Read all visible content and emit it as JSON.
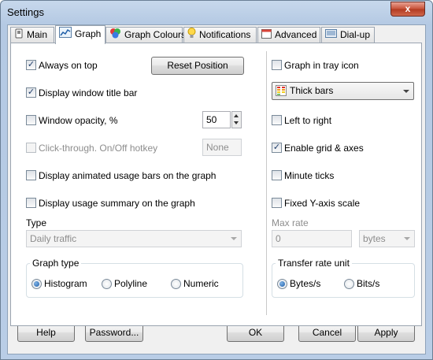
{
  "window": {
    "title": "Settings",
    "close_glyph": "x"
  },
  "tabs": [
    {
      "label": "Main",
      "icon": "phone-icon"
    },
    {
      "label": "Graph",
      "icon": "graph-icon",
      "active": true
    },
    {
      "label": "Graph Colours",
      "icon": "palette-icon"
    },
    {
      "label": "Notifications",
      "icon": "lightbulb-icon"
    },
    {
      "label": "Advanced",
      "icon": "calendar-icon"
    },
    {
      "label": "Dial-up",
      "icon": "modem-icon"
    }
  ],
  "left": {
    "always_on_top": {
      "label": "Always on top",
      "checked": true
    },
    "reset_position": "Reset Position",
    "display_title_bar": {
      "label": "Display window title bar",
      "checked": true
    },
    "window_opacity": {
      "label": "Window opacity, %",
      "checked": false,
      "value": "50"
    },
    "click_through": {
      "label": "Click-through. On/Off hotkey",
      "checked": false,
      "disabled": true,
      "hotkey": "None"
    },
    "animated_bars": {
      "label": "Display animated usage bars on the graph",
      "checked": false
    },
    "usage_summary": {
      "label": "Display usage summary on the graph",
      "checked": false
    },
    "type_label": "Type",
    "type_value": "Daily traffic",
    "graph_type": {
      "legend": "Graph type",
      "options": [
        "Histogram",
        "Polyline",
        "Numeric"
      ],
      "selected": "Histogram"
    }
  },
  "right": {
    "tray_icon": {
      "label": "Graph in tray icon",
      "checked": false
    },
    "style_select": "Thick bars",
    "left_to_right": {
      "label": "Left to right",
      "checked": false
    },
    "grid_axes": {
      "label": "Enable grid & axes",
      "checked": true
    },
    "minute_ticks": {
      "label": "Minute ticks",
      "checked": false
    },
    "fixed_y": {
      "label": "Fixed Y-axis scale",
      "checked": false
    },
    "max_rate_label": "Max rate",
    "max_rate_value": "0",
    "max_rate_unit": "bytes",
    "transfer_unit": {
      "legend": "Transfer rate unit",
      "options": [
        "Bytes/s",
        "Bits/s"
      ],
      "selected": "Bytes/s"
    }
  },
  "footer": {
    "help": "Help",
    "password": "Password...",
    "ok": "OK",
    "cancel": "Cancel",
    "apply": "Apply"
  },
  "colors": {
    "accent": "#1f5ea8",
    "titlebar": "#b9cde6",
    "close": "#c75037"
  }
}
